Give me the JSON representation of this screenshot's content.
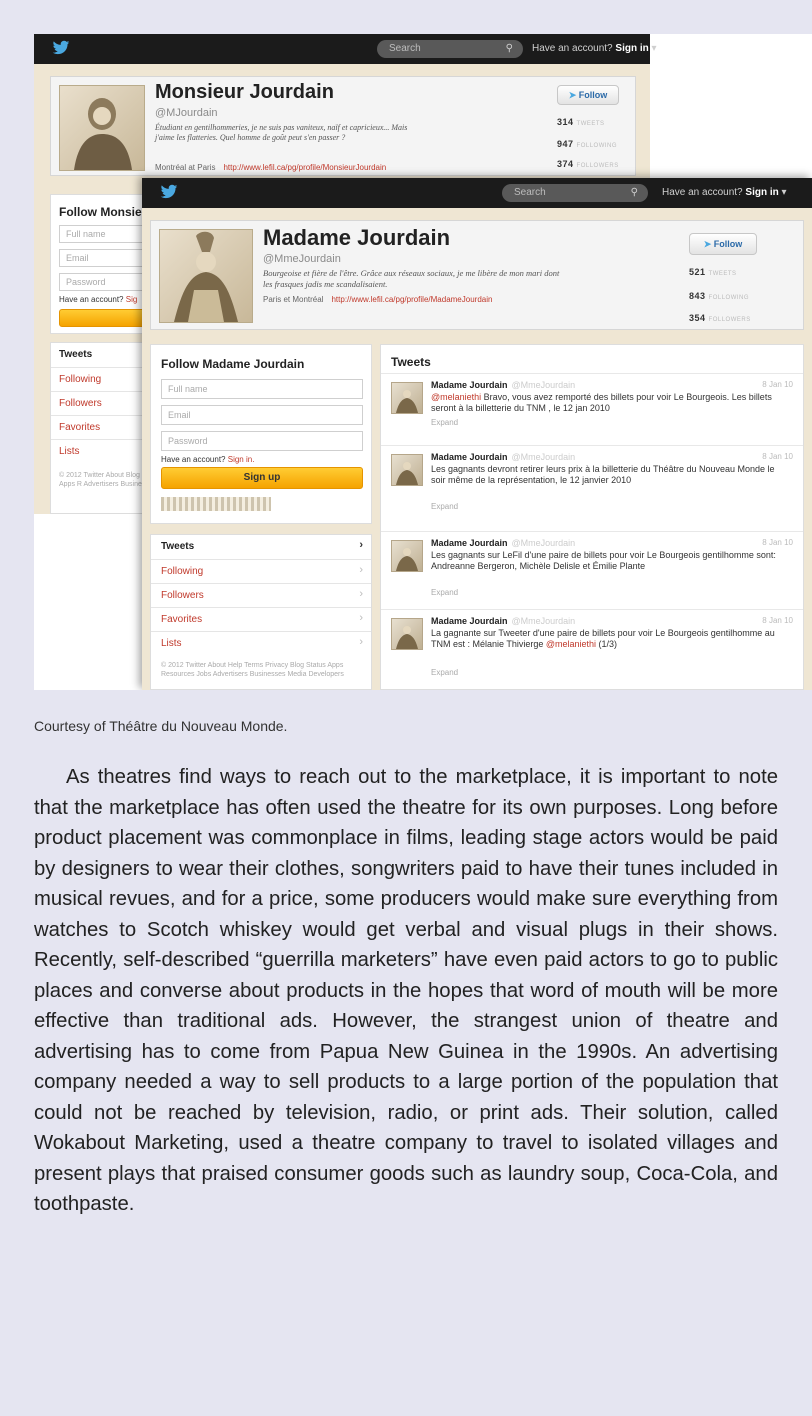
{
  "figure": {
    "back_profile": {
      "search_placeholder": "Search",
      "signin_prefix": "Have an account?",
      "signin_link": "Sign in",
      "name": "Monsieur Jourdain",
      "handle": "@MJourdain",
      "bio": "Étudiant en gentilhommeries, je ne suis pas vaniteux, naïf et capricieux... Mais j'aime les flatteries. Quel homme de goût peut s'en passer ?",
      "location": "Montréal at Paris",
      "url": "http://www.lefil.ca/pg/profile/MonsieurJourdain",
      "follow_label": "Follow",
      "stats": [
        {
          "value": "314",
          "label": "TWEETS"
        },
        {
          "value": "947",
          "label": "FOLLOWING"
        },
        {
          "value": "374",
          "label": "FOLLOWERS"
        }
      ],
      "follow_panel_title": "Follow Monsie",
      "fields": [
        "Full name",
        "Email",
        "Password"
      ],
      "have_account": "Have an account?",
      "have_account_link": "Sig",
      "nav": [
        "Tweets",
        "Following",
        "Followers",
        "Favorites",
        "Lists"
      ],
      "footer": "© 2012 Twitter About Blog Status Apps R Advertisers Business M"
    },
    "front_profile": {
      "search_placeholder": "Search",
      "signin_prefix": "Have an account?",
      "signin_link": "Sign in",
      "name": "Madame Jourdain",
      "handle": "@MmeJourdain",
      "bio": "Bourgeoise et fière de l'être. Grâce aux réseaux sociaux, je me libère de mon mari dont les frasques jadis me scandalisaient.",
      "location": "Paris et Montréal",
      "url": "http://www.lefil.ca/pg/profile/MadameJourdain",
      "follow_label": "Follow",
      "stats": [
        {
          "value": "521",
          "label": "TWEETS"
        },
        {
          "value": "843",
          "label": "FOLLOWING"
        },
        {
          "value": "354",
          "label": "FOLLOWERS"
        }
      ],
      "follow_panel_title": "Follow Madame Jourdain",
      "fields": [
        "Full name",
        "Email",
        "Password"
      ],
      "have_account": "Have an account?",
      "have_account_link": "Sign in.",
      "signup_label": "Sign up",
      "nav": [
        "Tweets",
        "Following",
        "Followers",
        "Favorites",
        "Lists"
      ],
      "footer": "© 2012 Twitter About Help Terms Privacy Blog Status Apps Resources Jobs Advertisers Businesses Media Developers",
      "tweets_title": "Tweets",
      "tweets": [
        {
          "name": "Madame Jourdain",
          "handle": "@MmeJourdain",
          "date": "8 Jan 10",
          "mention": "@melaniethi",
          "text": " Bravo, vous avez remporté des billets pour voir Le Bourgeois. Les billets seront à la billetterie du TNM , le 12 jan 2010",
          "expand": "Expand"
        },
        {
          "name": "Madame Jourdain",
          "handle": "@MmeJourdain",
          "date": "8 Jan 10",
          "mention": "",
          "text": "Les gagnants devront retirer leurs prix à la billetterie du Théâtre du Nouveau Monde le soir même de la représentation, le 12 janvier 2010",
          "expand": "Expand"
        },
        {
          "name": "Madame Jourdain",
          "handle": "@MmeJourdain",
          "date": "8 Jan 10",
          "mention": "",
          "text": "Les gagnants sur LeFil d'une paire de billets pour voir Le Bourgeois gentilhomme sont: Andreanne Bergeron, Michèle Delisle et Émilie Plante",
          "expand": "Expand"
        },
        {
          "name": "Madame Jourdain",
          "handle": "@MmeJourdain",
          "date": "8 Jan 10",
          "mention": "@melaniethi",
          "text": "La gagnante sur Tweeter d'une paire de billets pour voir Le Bourgeois gentilhomme au TNM est : Mélanie Thivierge ",
          "text_after": " (1/3)",
          "expand": "Expand"
        }
      ]
    }
  },
  "caption": "Courtesy of Théâtre du Nouveau Monde.",
  "paragraph": "As theatres find ways to reach out to the marketplace, it is important to note that the marketplace has often used the theatre for its own purposes. Long before product placement was commonplace in films, leading stage actors would be paid by designers to wear their clothes, songwriters paid to have their tunes included in musical revues, and for a price, some producers would make sure everything from watches to Scotch whiskey would get verbal and visual plugs in their shows. Recently, self-described “guerrilla marketers” have even paid actors to go to public places and converse about products in the hopes that word of mouth will be more effective than traditional ads. However, the strangest union of theatre and advertising has to come from Papua New Guinea in the 1990s. An advertising company needed a way to sell products to a large portion of the population that could not be reached by television, radio, or print ads. Their solution, called Wokabout Marketing, used a theatre company to travel to isolated villages and present plays that praised consumer goods such as laundry soup, Coca-Cola, and toothpaste."
}
